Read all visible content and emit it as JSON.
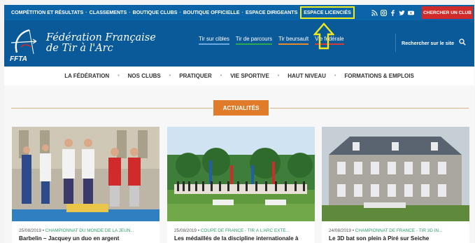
{
  "topbar": {
    "links": [
      "COMPÉTITION ET RÉSULTATS",
      "CLASSEMENTS",
      "BOUTIQUE CLUBS",
      "BOUTIQUE OFFICIELLE",
      "ESPACE DIRIGEANTS"
    ],
    "separator": "·",
    "espace_licencies": "ESPACE LICENCIÉS",
    "social_icons": [
      "rss-icon",
      "instagram-icon",
      "facebook-icon",
      "twitter-icon",
      "youtube-icon"
    ],
    "club_button": "CHERCHER UN CLUB"
  },
  "header": {
    "logo_text": "FFTA",
    "title_line1": "Fédération Française",
    "title_line2": "de Tir à l'Arc",
    "subnav": [
      "Tir sur cibles",
      "Tir de parcours",
      "Tir beursault",
      "Vie fédérale"
    ],
    "search_label": "Rechercher sur le site"
  },
  "mainnav": [
    "LA FÉDÉRATION",
    "NOS CLUBS",
    "PRATIQUER",
    "VIE SPORTIVE",
    "HAUT NIVEAU",
    "FORMATIONS & EMPLOIS"
  ],
  "news": {
    "heading": "ACTUALITÉS",
    "cards": [
      {
        "date": "25/08/2019",
        "category": "CHAMPIONNAT DU MONDE DE LA JEUN...",
        "title": "Barbelin – Jacquey un duo en argent"
      },
      {
        "date": "25/08/2019",
        "category": "COUPE DE FRANCE - TIR À L'ARC EXTÉ...",
        "title": "Les médaillés de la discipline internationale à Coutances"
      },
      {
        "date": "24/08/2019",
        "category": "CHAMPIONNAT DE FRANCE - TIR 3D IN...",
        "title": "Le 3D bat son plein à Piré sur Seiche"
      }
    ]
  },
  "colors": {
    "topbar": "#0b63a8",
    "header": "#0a5a99",
    "highlight_box": "#f2ea1a",
    "club_button": "#d12a2a",
    "actualites": "#e07b2a",
    "category": "#2a9d6a"
  }
}
